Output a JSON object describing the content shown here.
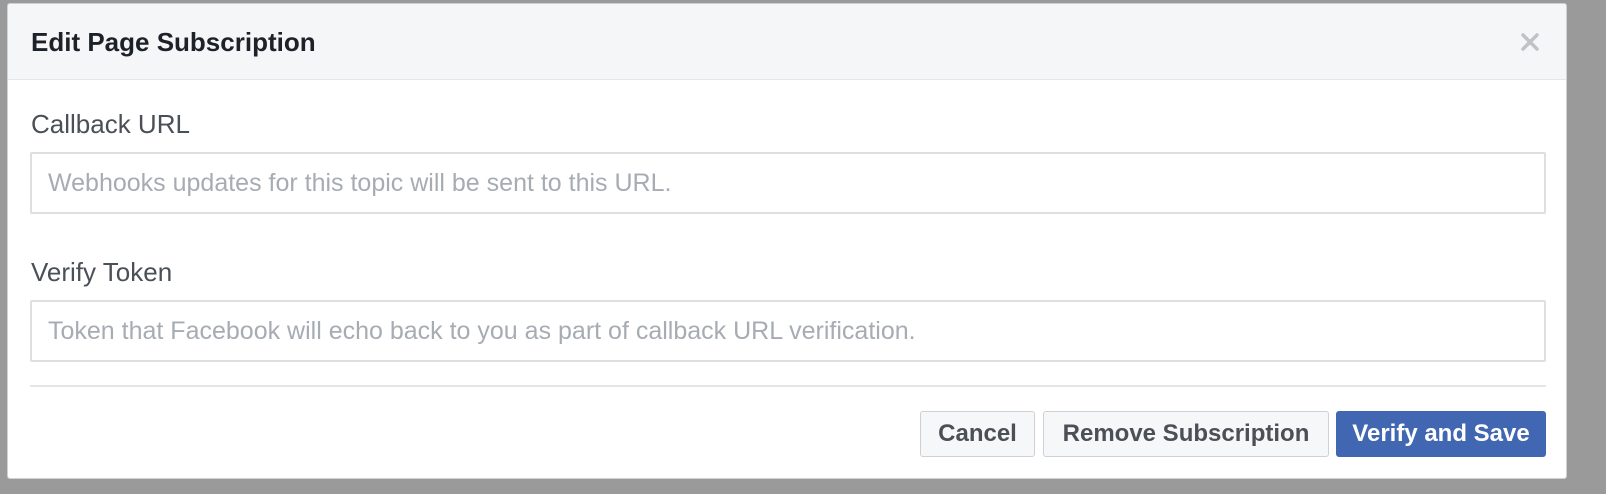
{
  "dialog": {
    "title": "Edit Page Subscription",
    "close_icon": "close-icon"
  },
  "fields": {
    "callback_url": {
      "label": "Callback URL",
      "value": "",
      "placeholder": "Webhooks updates for this topic will be sent to this URL."
    },
    "verify_token": {
      "label": "Verify Token",
      "value": "",
      "placeholder": "Token that Facebook will echo back to you as part of callback URL verification."
    }
  },
  "buttons": {
    "cancel": "Cancel",
    "remove": "Remove Subscription",
    "verify_save": "Verify and Save"
  },
  "colors": {
    "primary": "#4267b2",
    "header_bg": "#f5f6f7",
    "overlay": "#9a9a9a"
  }
}
